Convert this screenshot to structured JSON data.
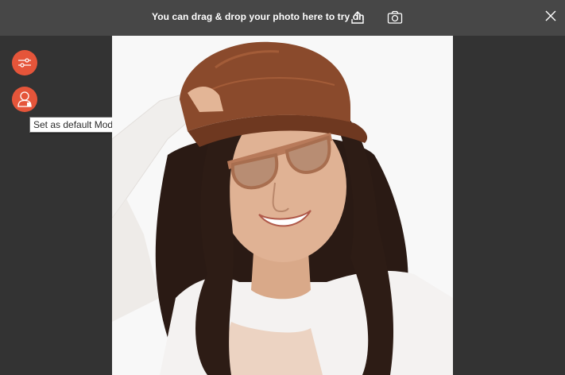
{
  "topbar": {
    "drop_hint": "You can drag & drop your photo here to try on",
    "upload_icon": "upload-icon",
    "camera_icon": "camera-icon",
    "close_icon": "close-icon"
  },
  "sidebar": {
    "adjust_icon": "sliders-icon",
    "model_icon": "user-icon"
  },
  "tooltip": {
    "text": "Set as default Model"
  },
  "photo": {
    "subject": "model-photo",
    "overlay": "sunglasses-overlay"
  },
  "colors": {
    "topbar": "#474747",
    "background": "#333333",
    "accent": "#e5553a",
    "glasses": "#b87a5a"
  }
}
